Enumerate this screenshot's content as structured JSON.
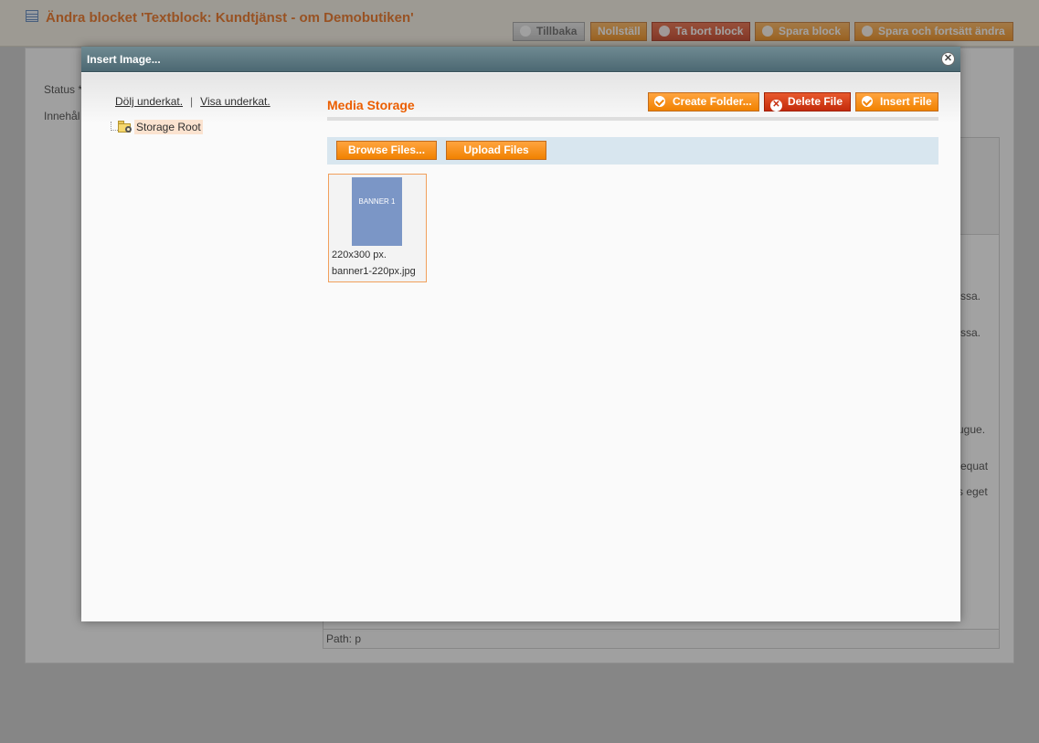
{
  "background": {
    "title": "Ändra blocket 'Textblock: Kundtjänst - om Demobutiken'",
    "buttons": {
      "back": "Tillbaka",
      "reset": "Nollställ",
      "delete": "Ta bort block",
      "save": "Spara block",
      "save_continue": "Spara och fortsätt ändra"
    },
    "labels": {
      "status": "Status *",
      "content": "Innehål"
    },
    "editor_fragments": [
      "ssa.",
      "ssa.",
      "ugue.",
      "equat",
      "s eget"
    ],
    "path_label": "Path: p"
  },
  "modal": {
    "title": "Insert Image...",
    "close_symbol": "✕",
    "tree": {
      "collapse_all": "Dölj underkat.",
      "separator": "|",
      "expand_all": "Visa underkat.",
      "root_label": "Storage Root"
    },
    "panel_title": "Media Storage",
    "buttons": {
      "create_folder": "Create Folder...",
      "delete_file": "Delete File",
      "insert_file": "Insert File",
      "browse_files": "Browse Files...",
      "upload_files": "Upload Files"
    },
    "files": [
      {
        "thumb_text": "BANNER 1",
        "dimensions": "220x300 px.",
        "filename": "banner1-220px.jpg"
      }
    ]
  },
  "colors": {
    "accent_orange": "#eb5e00",
    "button_orange": "#f18200",
    "button_red": "#c42b0b",
    "titlebar": "#4c6872",
    "upload_bar": "#d8e6ef",
    "thumb": "#7b96c6"
  }
}
